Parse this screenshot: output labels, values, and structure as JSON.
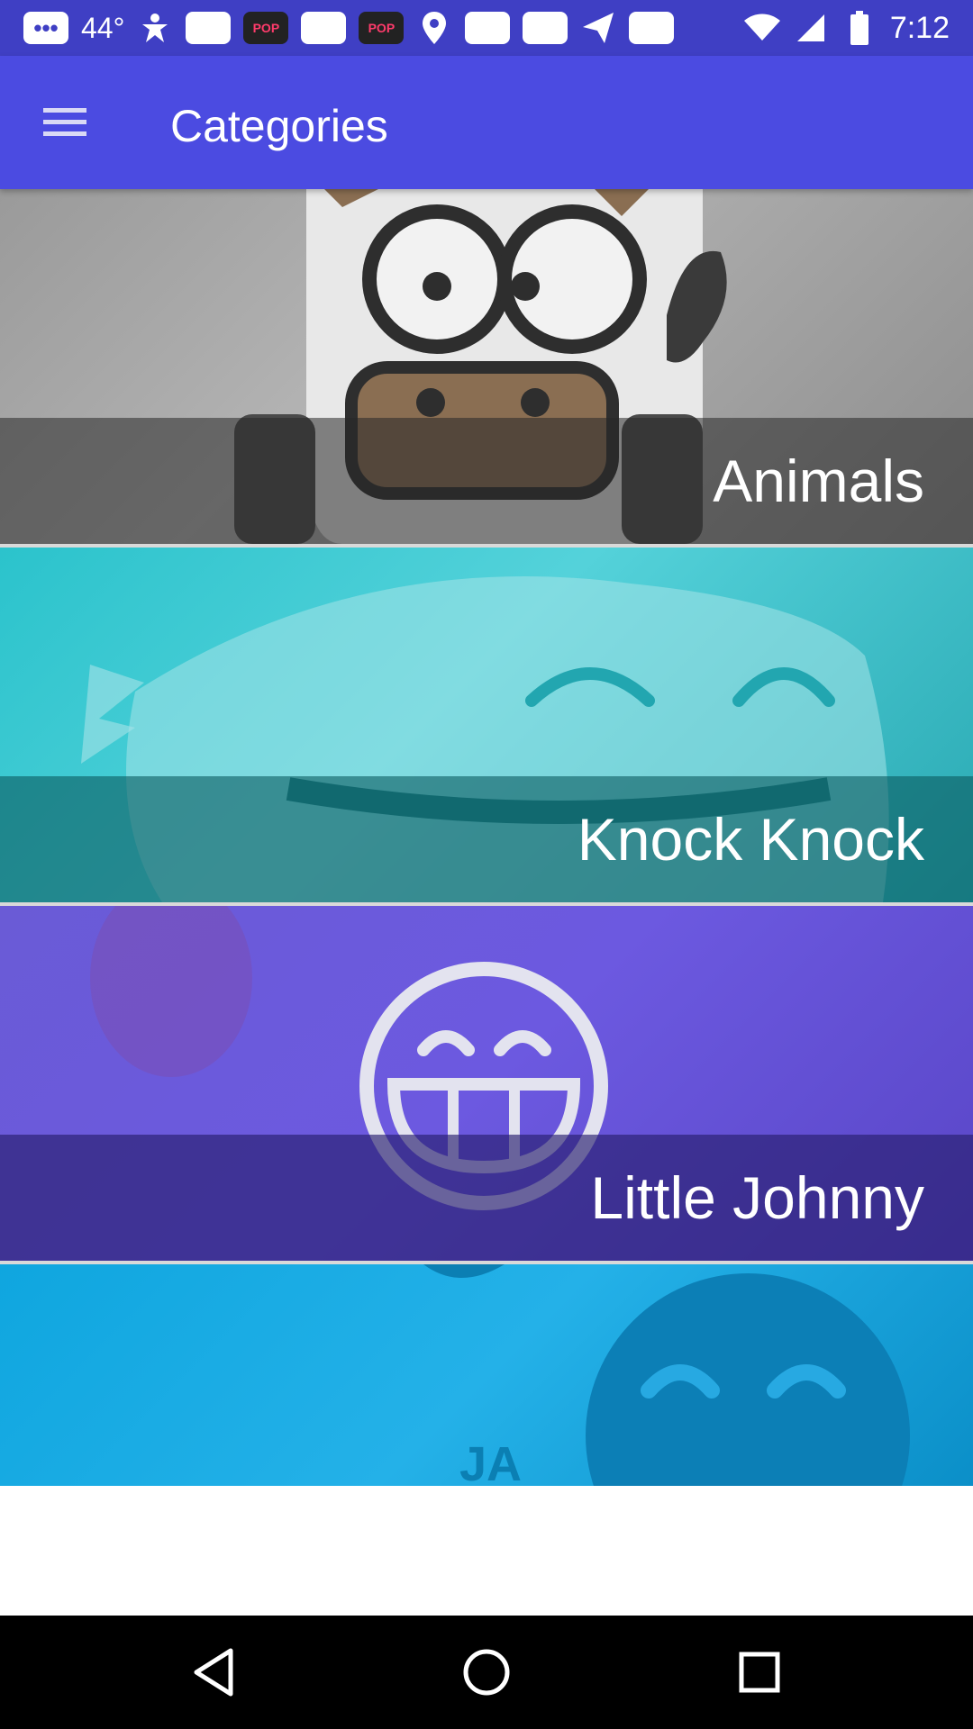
{
  "status_bar": {
    "temperature": "44°",
    "pop_label": "POP",
    "time": "7:12"
  },
  "app_bar": {
    "title": "Categories"
  },
  "categories": [
    {
      "label": "Animals"
    },
    {
      "label": "Knock Knock"
    },
    {
      "label": "Little Johnny"
    },
    {
      "label": ""
    }
  ],
  "nav_bar": {
    "icons": [
      "back-icon",
      "home-icon",
      "recents-icon"
    ]
  },
  "colors": {
    "status_bar": "#3f3fc4",
    "app_bar": "#4b4be1",
    "animals": "#9e9e9e",
    "knock_knock": "#33c4cd",
    "little_johnny": "#6656d8",
    "fourth": "#14a8e0"
  }
}
